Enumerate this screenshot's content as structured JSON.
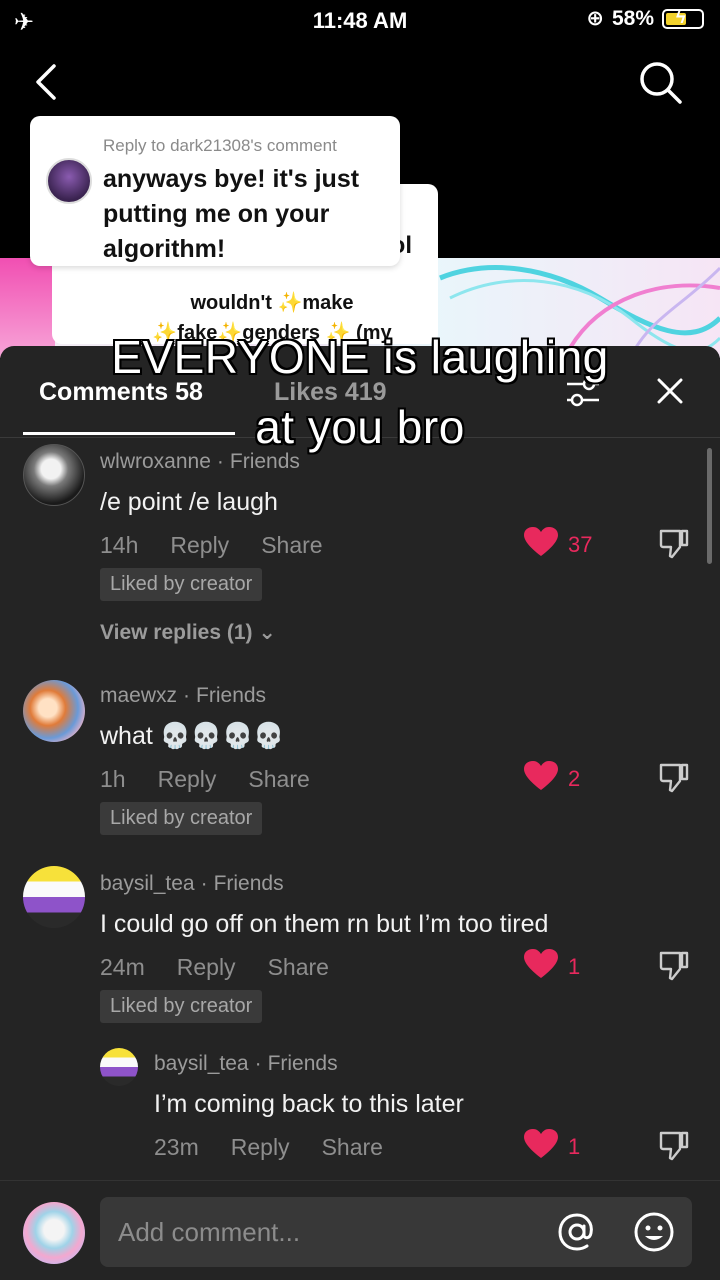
{
  "status_bar": {
    "time": "11:48 AM",
    "battery": "58%",
    "battery_level": 0.58
  },
  "video": {
    "reply_header": "Reply to dark21308's comment",
    "reply_message": "anyways bye! it's just putting me on your algorithm!",
    "back_bubble_fragment": "ol",
    "back_bubble_text": "wouldn't ✨make ✨fake✨genders ✨ (my",
    "caption_line1": "EVERYONE is laughing",
    "caption_line2": "at you bro"
  },
  "panel": {
    "comments_tab": "Comments 58",
    "likes_tab": "Likes 419"
  },
  "comments": [
    {
      "user": "wlwroxanne",
      "relation": "Friends",
      "text": "/e point /e laugh",
      "time": "14h",
      "reply": "Reply",
      "share": "Share",
      "likes": "37",
      "badge": "Liked by creator",
      "view_replies": "View replies (1)"
    },
    {
      "user": "maewxz",
      "relation": "Friends",
      "text": "what 💀💀💀💀",
      "time": "1h",
      "reply": "Reply",
      "share": "Share",
      "likes": "2",
      "badge": "Liked by creator"
    },
    {
      "user": "baysil_tea",
      "relation": "Friends",
      "text": "I could go off on them rn but I’m too tired",
      "time": "24m",
      "reply": "Reply",
      "share": "Share",
      "likes": "1",
      "badge": "Liked by creator"
    },
    {
      "user": "baysil_tea",
      "relation": "Friends",
      "text": "I’m coming back to this later",
      "time": "23m",
      "reply": "Reply",
      "share": "Share",
      "likes": "1"
    }
  ],
  "input": {
    "placeholder": "Add comment..."
  },
  "colors": {
    "panel": "#242424",
    "like": "#e8295d",
    "badge": "#3a3a3a"
  }
}
